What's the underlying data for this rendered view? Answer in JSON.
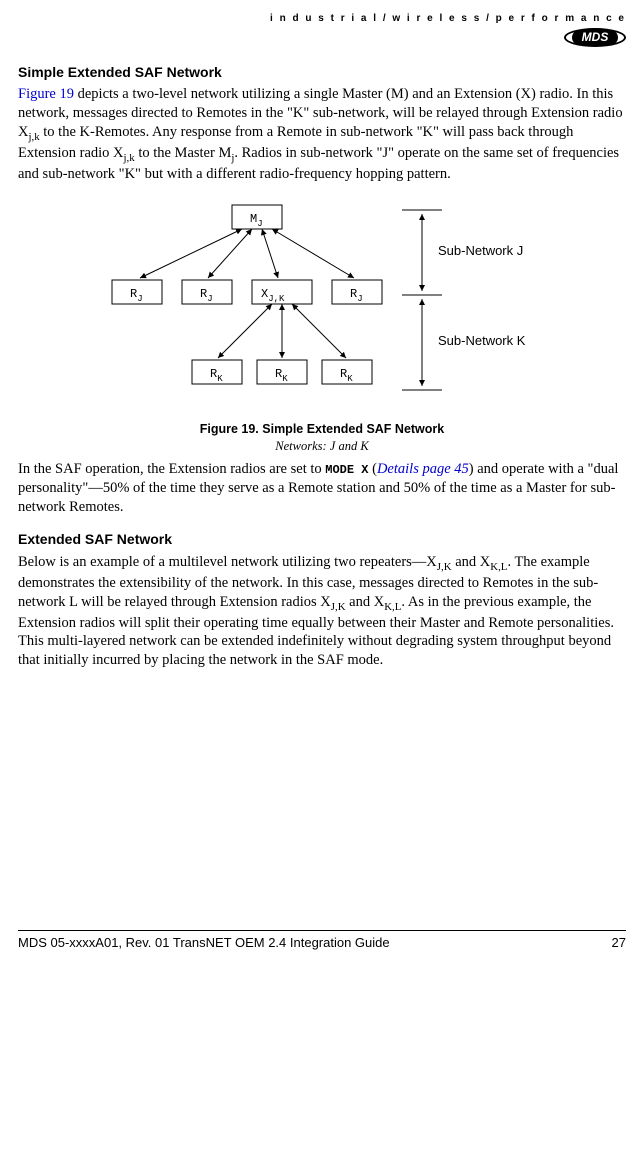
{
  "header": {
    "tagline": "i n d u s t r i a l / w i r e l e s s / p e r f o r m a n c e",
    "logo_text": "MDS"
  },
  "section1": {
    "title": "Simple Extended SAF Network",
    "figure_ref": "Figure 19",
    "para_a": " depicts a two-level network utilizing a single Master (M) and an Extension (X) radio. In this network, messages directed to Remotes in the \"K\" sub-network, will be relayed through Extension radio X",
    "sub_jk1": "j,k",
    "para_b": " to the K-Remotes. Any response from a Remote in sub-network \"K\" will pass back through Extension radio X",
    "sub_jk2": "j,k",
    "para_c": " to the Master M",
    "sub_j": "j",
    "para_d": ". Radios in sub-network \"J\" operate on the same set of frequencies and sub-network \"K\" but with a different radio-frequency hopping pattern.",
    "fig_caption": "Figure 19. Simple Extended SAF Network",
    "fig_sub": "Networks: J and K"
  },
  "chart_data": {
    "type": "diagram",
    "title": "Simple Extended SAF Network",
    "subtitle": "Networks: J and K",
    "nodes": [
      {
        "id": "MJ",
        "label": "M",
        "sub": "J",
        "row": 0,
        "col": 2
      },
      {
        "id": "RJ1",
        "label": "R",
        "sub": "J",
        "row": 1,
        "col": 0
      },
      {
        "id": "RJ2",
        "label": "R",
        "sub": "J",
        "row": 1,
        "col": 1
      },
      {
        "id": "XJK",
        "label": "X",
        "sub": "J,K",
        "row": 1,
        "col": 2
      },
      {
        "id": "RJ3",
        "label": "R",
        "sub": "J",
        "row": 1,
        "col": 3
      },
      {
        "id": "RK1",
        "label": "R",
        "sub": "K",
        "row": 2,
        "col": 1
      },
      {
        "id": "RK2",
        "label": "R",
        "sub": "K",
        "row": 2,
        "col": 2
      },
      {
        "id": "RK3",
        "label": "R",
        "sub": "K",
        "row": 2,
        "col": 3
      }
    ],
    "edges": [
      [
        "MJ",
        "RJ1"
      ],
      [
        "MJ",
        "RJ2"
      ],
      [
        "MJ",
        "XJK"
      ],
      [
        "MJ",
        "RJ3"
      ],
      [
        "XJK",
        "RK1"
      ],
      [
        "XJK",
        "RK2"
      ],
      [
        "XJK",
        "RK3"
      ]
    ],
    "brackets": [
      {
        "label": "Sub-Network  J",
        "span_rows": [
          0,
          1
        ]
      },
      {
        "label": "Sub-Network  K",
        "span_rows": [
          1,
          2
        ]
      }
    ]
  },
  "section2": {
    "para1_a": "In the SAF operation, the Extension radios are set to ",
    "mode_x": "MODE X",
    "para1_b": " (",
    "details_link": "Details page 45",
    "para1_c": ") and operate with a \"dual personality\"—50% of the time they serve as a Remote station and 50% of the time as a Master for sub-network Remotes.",
    "title2": "Extended SAF Network",
    "para2_a": "Below is an example of a multilevel network utilizing two repeaters—X",
    "sub_JK": "J,K",
    "para2_b": " and X",
    "sub_KL": "K,L",
    "para2_c": ". The example demonstrates the extensibility of the network. In this case, messages directed to Remotes in the sub-network L will be relayed through Extension radios X",
    "sub_JK2": "J,K",
    "para2_d": " and X",
    "sub_KL2": "K,L",
    "para2_e": ". As in the previous example, the Extension radios will split their operating time equally between their Master and Remote personalities. This multi-layered network can be extended indefinitely without degrading system throughput beyond that initially incurred by placing the network in the SAF mode."
  },
  "footer": {
    "left": "MDS 05-xxxxA01, Rev.  01   TransNET OEM 2.4 Integration Guide",
    "right": "27"
  },
  "labels": {
    "subnet_j": "Sub-Network  J",
    "subnet_k": "Sub-Network  K"
  }
}
